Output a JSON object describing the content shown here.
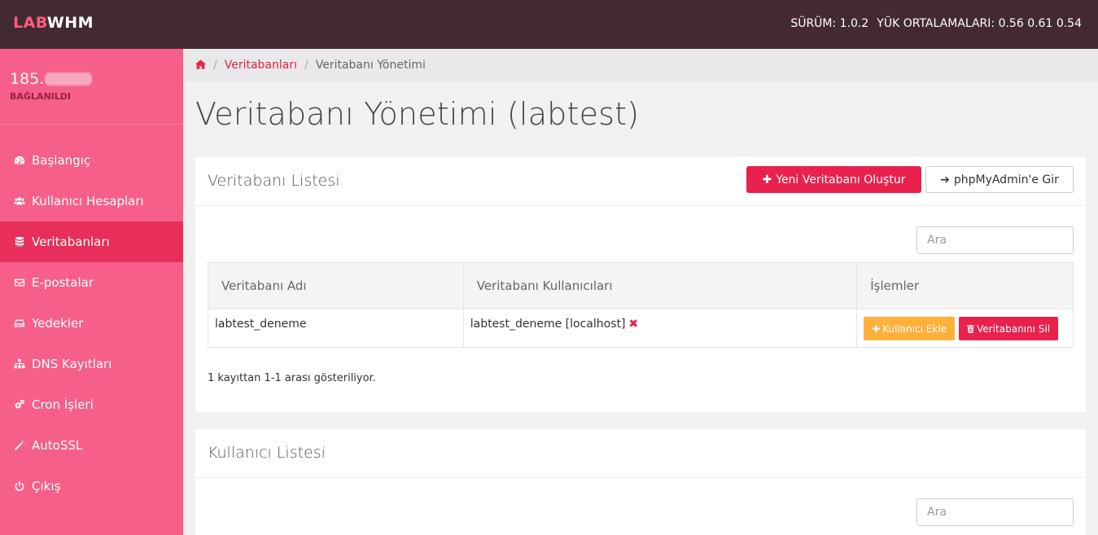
{
  "app": {
    "logo_part1": "LAB",
    "logo_part2": "WHM",
    "version": "SÜRÜM: 1.0.2",
    "load_avg": "YÜK ORTALAMALARI: 0.56 0.61 0.54"
  },
  "sidebar": {
    "server_ip_prefix": "185.",
    "status": "BAĞLANILDI",
    "items": [
      {
        "label": "Başlangıç",
        "icon": "dashboard-icon"
      },
      {
        "label": "Kullanıcı Hesapları",
        "icon": "users-icon"
      },
      {
        "label": "Veritabanları",
        "icon": "database-icon",
        "active": true
      },
      {
        "label": "E-postalar",
        "icon": "envelope-icon"
      },
      {
        "label": "Yedekler",
        "icon": "hdd-icon"
      },
      {
        "label": "DNS Kayıtları",
        "icon": "sitemap-icon"
      },
      {
        "label": "Cron İşleri",
        "icon": "cogs-icon"
      },
      {
        "label": "AutoSSL",
        "icon": "magic-wand-icon"
      },
      {
        "label": "Çıkış",
        "icon": "power-icon"
      }
    ]
  },
  "breadcrumb": {
    "home_icon": "home-icon",
    "link": "Veritabanları",
    "current": "Veritabanı Yönetimi"
  },
  "page": {
    "title": "Veritabanı Yönetimi (labtest)"
  },
  "db_panel": {
    "title": "Veritabanı Listesi",
    "create_button": "Yeni Veritabanı Oluştur",
    "phpmyadmin_button": "phpMyAdmin'e Gir",
    "search_placeholder": "Ara",
    "columns": [
      "Veritabanı Adı",
      "Veritabanı Kullanıcıları",
      "İşlemler"
    ],
    "rows": [
      {
        "name": "labtest_deneme",
        "users": "labtest_deneme [localhost]",
        "add_user_label": "Kullanıcı Ekle",
        "delete_label": "Veritabanını Sil"
      }
    ],
    "paging_info": "1 kayıttan 1-1 arası gösteriliyor."
  },
  "user_panel": {
    "title": "Kullanıcı Listesi",
    "search_placeholder": "Ara"
  },
  "colors": {
    "accent": "#e8224d",
    "sidebar": "#f55f89",
    "topbar": "#432a31",
    "warning": "#ffb03b"
  }
}
